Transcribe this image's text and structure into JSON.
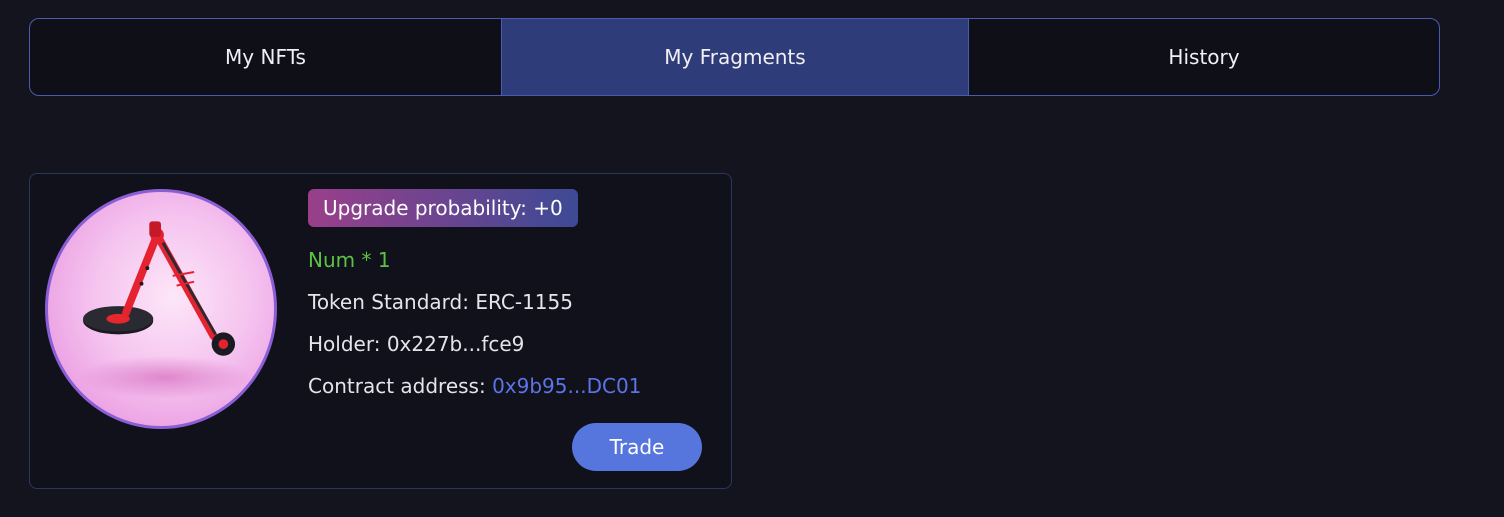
{
  "tabs": [
    {
      "label": "My NFTs"
    },
    {
      "label": "My Fragments"
    },
    {
      "label": "History"
    }
  ],
  "active_tab": "My Fragments",
  "card": {
    "badge": "Upgrade probability: +0",
    "num": "Num * 1",
    "token_standard_label": "Token Standard:",
    "token_standard_value": "ERC-1155",
    "holder_label": "Holder:",
    "holder_value": "0x227b...fce9",
    "contract_label": "Contract address:",
    "contract_value": "0x9b95...DC01",
    "trade_label": "Trade",
    "image_icon": "scooter-icon"
  },
  "colors": {
    "background": "#14141f",
    "accent": "#5676dd",
    "active_tab": "#2f3c7a",
    "num_green": "#5cc244",
    "link_blue": "#5b74e6"
  }
}
